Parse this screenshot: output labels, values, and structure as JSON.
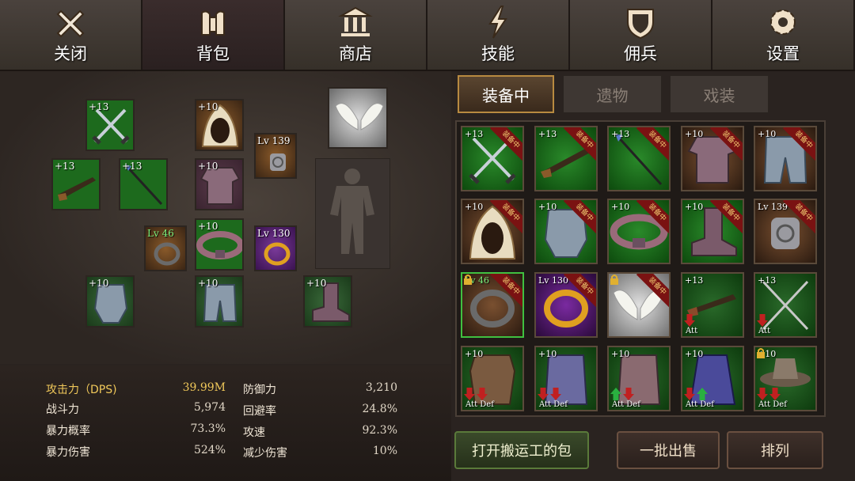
{
  "nav": {
    "tabs": [
      {
        "label": "关闭",
        "icon": "close-icon"
      },
      {
        "label": "背包",
        "icon": "backpack-icon",
        "active": true
      },
      {
        "label": "商店",
        "icon": "shop-icon"
      },
      {
        "label": "技能",
        "icon": "skill-lightning-icon"
      },
      {
        "label": "佣兵",
        "icon": "mercenary-shield-icon"
      },
      {
        "label": "设置",
        "icon": "settings-gear-icon"
      }
    ]
  },
  "equipped": {
    "sword": "+13",
    "rifle": "+13",
    "spear": "+13",
    "hood": "+10",
    "amulet": "Lv 139",
    "armor": "+10",
    "ring1": "Lv 46",
    "belt": "+10",
    "ring2": "Lv 130",
    "gauntlets": "+10",
    "legs": "+10",
    "boots": "+10"
  },
  "stats": {
    "left": [
      {
        "label": "攻击力（DPS)",
        "value": "39.99M"
      },
      {
        "label": "战斗力",
        "value": "5,974"
      },
      {
        "label": "暴力概率",
        "value": "73.3%"
      },
      {
        "label": "暴力伤害",
        "value": "524%"
      }
    ],
    "right": [
      {
        "label": "防御力",
        "value": "3,210"
      },
      {
        "label": "回避率",
        "value": "24.8%"
      },
      {
        "label": "攻速",
        "value": "92.3%"
      },
      {
        "label": "减少伤害",
        "value": "10%"
      }
    ]
  },
  "inventory": {
    "tabs": [
      "装备中",
      "遗物",
      "戏装"
    ],
    "equipped_badge": "装备中",
    "att_label": "Att",
    "def_label": "Def",
    "items": [
      {
        "level": "+13",
        "kind": "crossed-swords"
      },
      {
        "level": "+13",
        "kind": "rifle"
      },
      {
        "level": "+13",
        "kind": "spear"
      },
      {
        "level": "+10",
        "kind": "armor"
      },
      {
        "level": "+10",
        "kind": "leg-armor"
      },
      {
        "level": "+10",
        "kind": "hood"
      },
      {
        "level": "+10",
        "kind": "gauntlet"
      },
      {
        "level": "+10",
        "kind": "belt"
      },
      {
        "level": "+10",
        "kind": "boots"
      },
      {
        "level": "Lv 139",
        "kind": "amulet"
      },
      {
        "level": "Lv 46",
        "kind": "ring"
      },
      {
        "level": "Lv 130",
        "kind": "gold-ring"
      },
      {
        "level": "",
        "kind": "wings"
      },
      {
        "level": "+13",
        "kind": "rifle"
      },
      {
        "level": "+13",
        "kind": "crossed-spears"
      },
      {
        "level": "+10",
        "kind": "leather-armor"
      },
      {
        "level": "+10",
        "kind": "robe"
      },
      {
        "level": "+10",
        "kind": "cloth-armor"
      },
      {
        "level": "+10",
        "kind": "mage-robe"
      },
      {
        "level": "+10",
        "kind": "hat"
      }
    ]
  },
  "buttons": {
    "porter_bag": "打开搬运工的包",
    "batch_sell": "一批出售",
    "sort": "排列"
  },
  "colors": {
    "accent_gold": "#f0c85a",
    "item_green": "#1d6a1d",
    "badge_red": "#7a1212"
  }
}
